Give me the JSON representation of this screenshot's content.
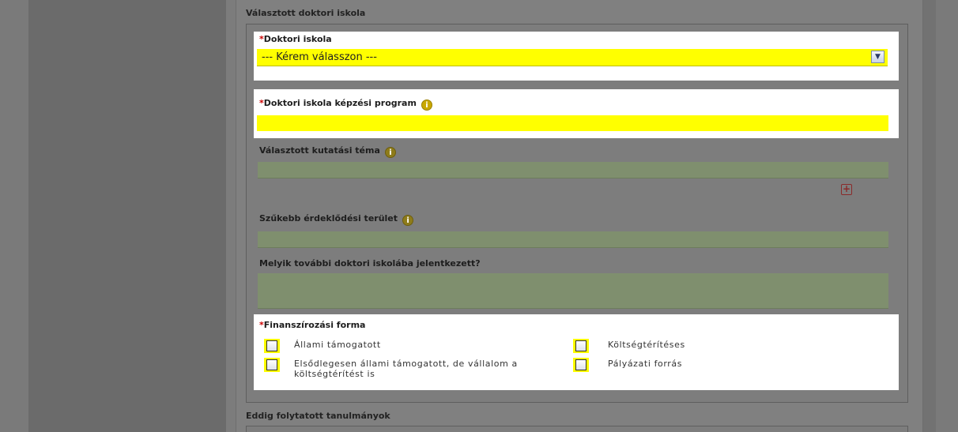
{
  "sections": {
    "chosen_school_title": "Választott doktori iskola",
    "previous_studies_title": "Eddig folytatott tanulmányok"
  },
  "doctoral_school": {
    "required_mark": "*",
    "label": "Doktori iskola",
    "selected_value": "--- Kérem válasszon ---",
    "dropdown_icon": "chevron-down-icon"
  },
  "training_program": {
    "required_mark": "*",
    "label": "Doktori iskola képzési program",
    "value": ""
  },
  "research_topic": {
    "label": "Választott kutatási téma",
    "value": "",
    "add_icon": "plus-icon"
  },
  "narrow_interest": {
    "label": "Szűkebb érdeklődési terület",
    "value": ""
  },
  "other_school": {
    "label": "Melyik további doktori iskolába jelentkezett?",
    "value": ""
  },
  "funding": {
    "required_mark": "*",
    "label": "Finanszírozási forma",
    "options": [
      {
        "label": "Állami támogatott",
        "checked": false
      },
      {
        "label": "Költségtérítéses",
        "checked": false
      },
      {
        "label": "Elsődlegesen állami támogatott, de vállalom a költségtérítést is",
        "checked": false
      },
      {
        "label": "Pályázati forrás",
        "checked": false
      }
    ]
  },
  "colors": {
    "required_field_highlight": "#ffff00",
    "optional_field_background": "#7f8f6e",
    "required_mark": "#cc0000",
    "info_icon": "#c9a800"
  }
}
